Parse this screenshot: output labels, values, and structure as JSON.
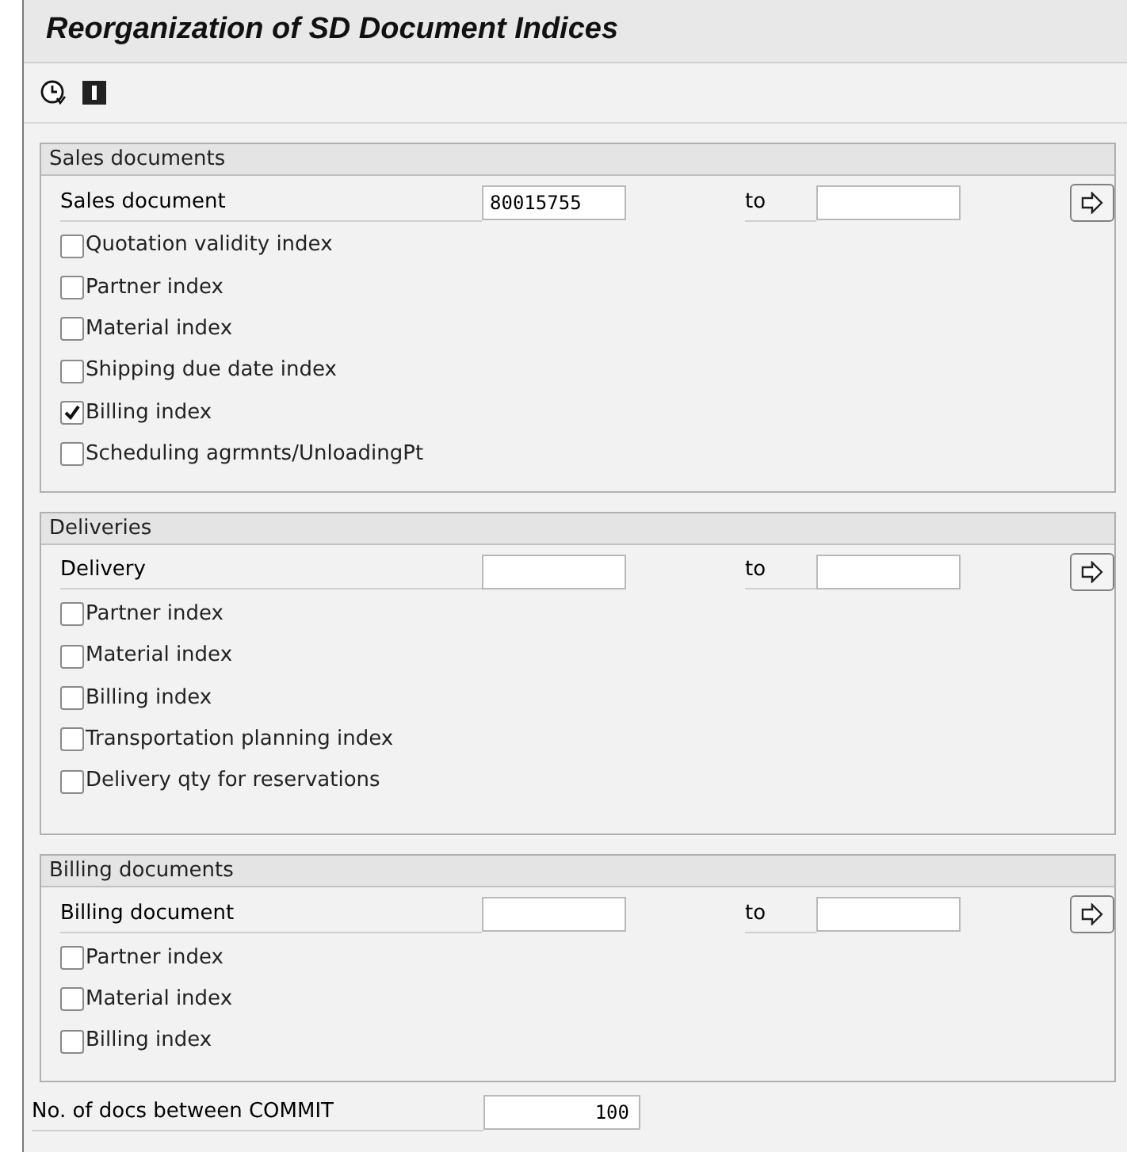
{
  "window": {
    "title": "Reorganization of SD Document Indices"
  },
  "sections": [
    {
      "title": "Sales documents",
      "range": {
        "label": "Sales document",
        "from": "80015755",
        "to_label": "to"
      },
      "options": [
        {
          "label": "Quotation validity index",
          "checked": false
        },
        {
          "label": "Partner index",
          "checked": false
        },
        {
          "label": "Material index",
          "checked": false
        },
        {
          "label": "Shipping due date index",
          "checked": false
        },
        {
          "label": "Billing index",
          "checked": true
        },
        {
          "label": "Scheduling agrmnts/UnloadingPt",
          "checked": false
        }
      ]
    },
    {
      "title": "Deliveries",
      "range": {
        "label": "Delivery",
        "to_label": "to"
      },
      "options": [
        {
          "label": "Partner index",
          "checked": false
        },
        {
          "label": "Material index",
          "checked": false
        },
        {
          "label": "Billing index",
          "checked": false
        },
        {
          "label": "Transportation planning index",
          "checked": false
        },
        {
          "label": "Delivery qty for reservations",
          "checked": false
        }
      ]
    },
    {
      "title": "Billing documents",
      "range": {
        "label": "Billing document",
        "to_label": "to"
      },
      "options": [
        {
          "label": "Partner index",
          "checked": false
        },
        {
          "label": "Material index",
          "checked": false
        },
        {
          "label": "Billing index",
          "checked": false
        }
      ]
    }
  ],
  "commit": {
    "label": "No. of docs between COMMIT",
    "value": "100"
  }
}
